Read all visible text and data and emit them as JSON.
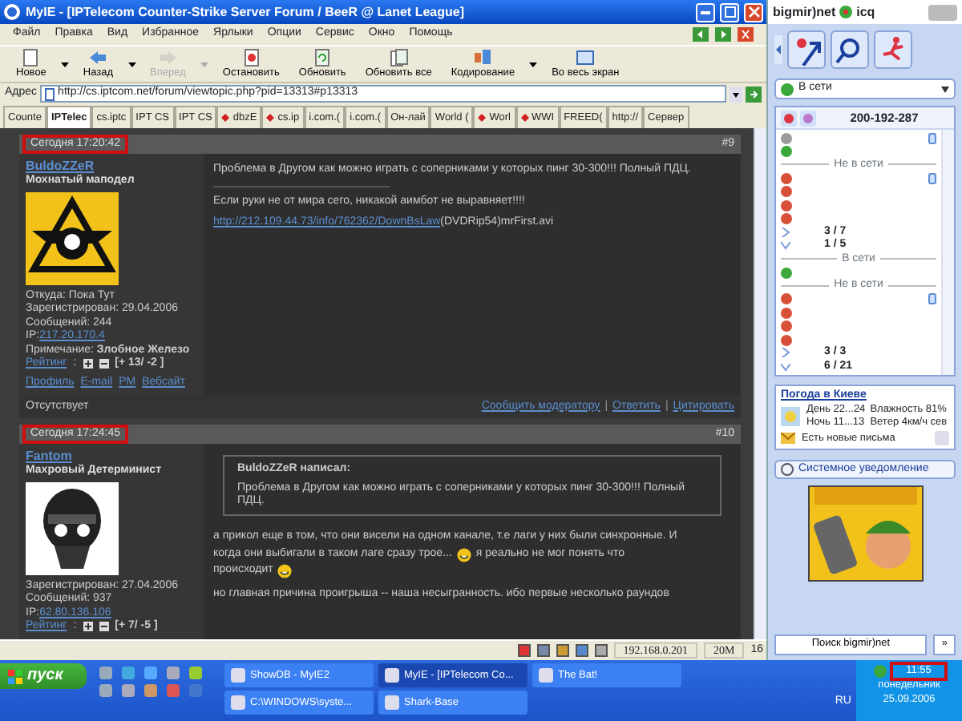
{
  "window": {
    "title": "MyIE - [IPTelecom Counter-Strike Server Forum / BeeR @ Lanet League]"
  },
  "menu": [
    "Файл",
    "Правка",
    "Вид",
    "Избранное",
    "Ярлыки",
    "Опции",
    "Сервис",
    "Окно",
    "Помощь"
  ],
  "toolbar": [
    {
      "label": "Новое",
      "disabled": false,
      "dropdown": true
    },
    {
      "label": "Назад",
      "disabled": false,
      "dropdown": true
    },
    {
      "label": "Вперед",
      "disabled": true,
      "dropdown": true
    },
    {
      "label": "Остановить",
      "disabled": false,
      "dropdown": false
    },
    {
      "label": "Обновить",
      "disabled": false,
      "dropdown": false
    },
    {
      "label": "Обновить все",
      "disabled": false,
      "dropdown": false
    },
    {
      "label": "Кодирование",
      "disabled": false,
      "dropdown": true
    },
    {
      "label": "Во весь экран",
      "disabled": false,
      "dropdown": false
    }
  ],
  "address": {
    "label": "Адрес",
    "value": "http://cs.iptcom.net/forum/viewtopic.php?pid=13313#p13313"
  },
  "tabs": [
    {
      "label": "Counte",
      "selected": false,
      "flagged": false
    },
    {
      "label": "IPTelec",
      "selected": true,
      "flagged": false
    },
    {
      "label": "cs.iptc",
      "selected": false,
      "flagged": false
    },
    {
      "label": "IPT CS",
      "selected": false,
      "flagged": false
    },
    {
      "label": "IPT CS",
      "selected": false,
      "flagged": false
    },
    {
      "label": "dbzE",
      "selected": false,
      "flagged": true
    },
    {
      "label": "cs.ip",
      "selected": false,
      "flagged": true
    },
    {
      "label": "i.com.(",
      "selected": false,
      "flagged": false
    },
    {
      "label": "i.com.(",
      "selected": false,
      "flagged": false
    },
    {
      "label": "Он-лай",
      "selected": false,
      "flagged": false
    },
    {
      "label": "World (",
      "selected": false,
      "flagged": false
    },
    {
      "label": "Worl",
      "selected": false,
      "flagged": true
    },
    {
      "label": "WWI",
      "selected": false,
      "flagged": true
    },
    {
      "label": "FREED(",
      "selected": false,
      "flagged": false
    },
    {
      "label": "http://",
      "selected": false,
      "flagged": false
    },
    {
      "label": "Сервер",
      "selected": false,
      "flagged": false
    }
  ],
  "posts": [
    {
      "time": "Сегодня 17:20:42",
      "number": "#9",
      "author": "BuldoZZeR",
      "rank": "Мохнатый маподел",
      "avatar": {
        "kind": "emblem"
      },
      "info": [
        {
          "kind": "text",
          "text": "Откуда: Пока Тут"
        },
        {
          "kind": "text",
          "text": "Зарегистрирован: 29.04.2006"
        },
        {
          "kind": "text",
          "text": "Сообщений: 244"
        },
        {
          "kind": "ip",
          "label": "IP: ",
          "value": "217.20.170.4"
        },
        {
          "kind": "text",
          "text": "Примечание: **Злобное Железо**"
        },
        {
          "kind": "rating",
          "label": "Рейтинг",
          "separator": ":",
          "value": "[+ 13/ -2 ]"
        },
        {
          "kind": "links",
          "items": [
            "Профиль",
            "E-mail",
            "PM",
            "Вебсайт"
          ]
        }
      ],
      "status": "Отсутствует",
      "body": [
        {
          "kind": "lines",
          "lines": [
            [
              {
                "text": "Проблема в Другом как можно играть с соперниками у которых пинг 30-300!!! Полный ПДЦ."
              }
            ]
          ]
        },
        {
          "kind": "rule"
        },
        {
          "kind": "lines",
          "lines": [
            [
              {
                "text": "Если руки не от мира сего, никакой аимбот не выравняет!!!!"
              }
            ]
          ]
        },
        {
          "kind": "link",
          "url": "http://212.109.44.73/info/762362/DownBsLaw",
          "text": "(DVDRip54)mrFirst.avi"
        }
      ],
      "actions": [
        {
          "kind": "link",
          "text": "Сообщить модератору"
        },
        {
          "kind": "separator",
          "text": "|"
        },
        {
          "kind": "link",
          "text": "Ответить"
        },
        {
          "kind": "separator",
          "text": "|"
        },
        {
          "kind": "link",
          "text": "Цитировать"
        }
      ]
    },
    {
      "time": "Сегодня 17:24:45",
      "number": "#10",
      "author": "Fantom",
      "rank": "Махровый Детерминист",
      "avatar": {
        "kind": "skull"
      },
      "info": [
        {
          "kind": "text",
          "text": "Зарегистрирован: 27.04.2006"
        },
        {
          "kind": "text",
          "text": "Сообщений: 937"
        },
        {
          "kind": "ip",
          "label": "IP: ",
          "value": "62.80.136.106"
        },
        {
          "kind": "rating",
          "label": "Рейтинг",
          "separator": ":",
          "value": "[+ 7/ -5 ]"
        }
      ],
      "quote": {
        "author": "BuldoZZeR написал:",
        "text": "Проблема в Другом как можно играть с соперниками у которых пинг 30-300!!! Полный ПДЦ."
      },
      "body": [
        {
          "kind": "lines",
          "lines": [
            [
              {
                "text": "а прикол еще в том, что они висели на одном канале, т.е лаги у них были синхронные. И"
              }
            ],
            [
              {
                "text": "когда они выбигали в таком лаге сразу трое..."
              },
              {
                "smiley": true
              },
              {
                "text": "я реально не мог понять что"
              }
            ],
            [
              {
                "text": "происходит"
              },
              {
                "smiley": true
              }
            ]
          ]
        },
        {
          "kind": "lines",
          "lines": [
            [
              {
                "text": "но главная причина проигрыша -- наша несыгранность. ибо первые несколько раундов"
              }
            ]
          ]
        }
      ]
    }
  ],
  "status_bar": {
    "ip": "192.168.0.201",
    "memory": "20M",
    "count": "16"
  },
  "icq": {
    "brand": "bigmir)net",
    "product": "icq",
    "status": "В сети",
    "number": "200-192-287",
    "contacts": [
      {
        "kind": "contact",
        "color": "#9a9a9a",
        "note": true
      },
      {
        "kind": "contact",
        "color": "#3aa83a",
        "note": false
      },
      {
        "kind": "divider",
        "label": "Не в сети"
      },
      {
        "kind": "contact",
        "color": "#d8503a",
        "note": true
      },
      {
        "kind": "contact",
        "color": "#d8503a",
        "note": false
      },
      {
        "kind": "contact",
        "color": "#d8503a",
        "note": false
      },
      {
        "kind": "contact",
        "color": "#d8503a",
        "note": false
      },
      {
        "kind": "group",
        "count": "3 / 7",
        "expanded": false
      },
      {
        "kind": "group",
        "count": "1 / 5",
        "expanded": true
      },
      {
        "kind": "divider",
        "label": "В сети"
      },
      {
        "kind": "contact",
        "color": "#3aa83a",
        "note": false
      },
      {
        "kind": "divider",
        "label": "Не в сети"
      },
      {
        "kind": "contact",
        "color": "#d8503a",
        "note": true
      },
      {
        "kind": "contact",
        "color": "#d8503a",
        "note": false
      },
      {
        "kind": "contact",
        "color": "#d8503a",
        "note": false
      },
      {
        "kind": "contact",
        "color": "#d8503a",
        "note": false
      },
      {
        "kind": "group",
        "count": "3 / 3",
        "expanded": false
      },
      {
        "kind": "group",
        "count": "6 / 21",
        "expanded": true
      }
    ],
    "weather": {
      "title": "Погода в Киеве",
      "day": "День 22...24",
      "humidity": "Влажность 81%",
      "night": "Ночь 11...13",
      "wind": "Ветер 4км/ч сев",
      "mail": "Есть новые письма"
    },
    "notice": "Системное уведомление",
    "search_button": "Поиск bigmir)net",
    "more_button": "»"
  },
  "taskbar": {
    "start": "пуск",
    "tasks": [
      {
        "label": "ShowDB - MyIE2",
        "selected": false
      },
      {
        "label": "MyIE - [IPTelecom Co...",
        "selected": true
      },
      {
        "label": "The Bat!",
        "selected": false
      },
      {
        "label": "C:\\WINDOWS\\syste...",
        "selected": false
      },
      {
        "label": "Shark-Base",
        "selected": false
      }
    ],
    "language": "RU",
    "time": "11:55",
    "weekday": "понедельник",
    "date": "25.09.2006"
  }
}
